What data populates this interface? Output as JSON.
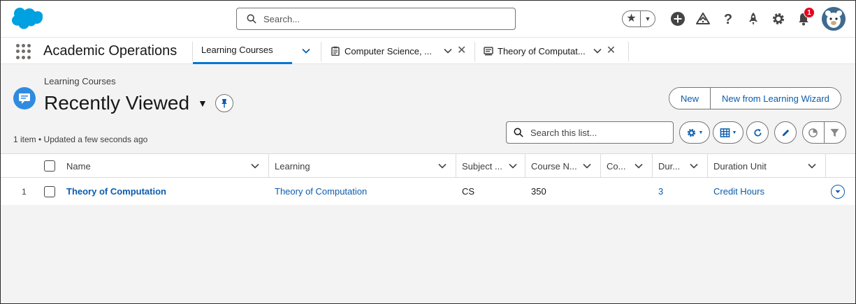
{
  "header": {
    "search_placeholder": "Search...",
    "notification_count": "1",
    "icons": [
      "favorites-star-icon",
      "add-icon",
      "trailhead-icon",
      "help-icon",
      "setup-rocket-icon",
      "gear-icon",
      "bell-icon",
      "avatar"
    ]
  },
  "app_nav": {
    "app_name": "Academic Operations",
    "tabs": [
      {
        "label": "Learning Courses",
        "active": true
      },
      {
        "label": "Computer Science, ...",
        "icon": "clipboard-icon"
      },
      {
        "label": "Theory of Computat...",
        "icon": "course-icon"
      }
    ]
  },
  "list": {
    "breadcrumb": "Learning Courses",
    "title": "Recently Viewed",
    "meta": "1 item • Updated a few seconds ago",
    "buttons": {
      "new": "New",
      "new_from_wizard": "New from Learning Wizard"
    },
    "search_placeholder": "Search this list...",
    "columns": [
      "Name",
      "Learning",
      "Subject ...",
      "Course N...",
      "Co...",
      "Dur...",
      "Duration Unit"
    ],
    "rows": [
      {
        "num": "1",
        "name": "Theory of Computation",
        "learning": "Theory of Computation",
        "subject": "CS",
        "course_number": "350",
        "co": "",
        "duration": "3",
        "duration_unit": "Credit Hours"
      }
    ]
  },
  "colors": {
    "accent": "#0176d3",
    "link": "#0b5cab",
    "brand_cloud": "#00a1e0",
    "badge": "#ea001e"
  }
}
